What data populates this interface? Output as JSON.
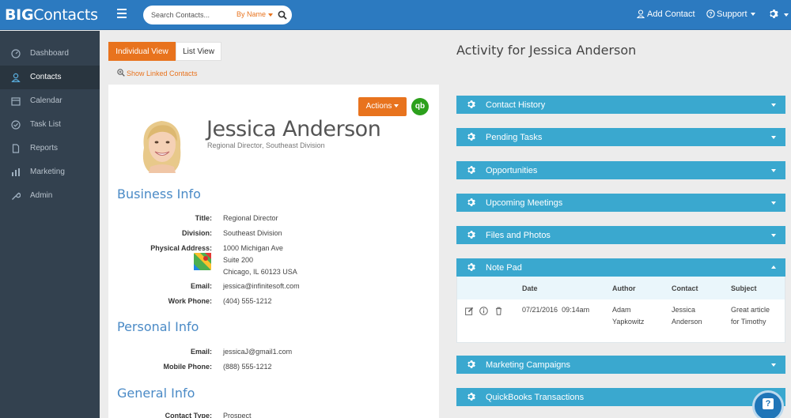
{
  "app": {
    "logo_bold": "BIG",
    "logo_thin": "Contacts"
  },
  "search": {
    "placeholder": "Search Contacts...",
    "mode": "By Name"
  },
  "header": {
    "add_contact": "Add Contact",
    "support": "Support"
  },
  "sidebar": {
    "items": [
      {
        "label": "Dashboard",
        "icon": "dashboard-icon"
      },
      {
        "label": "Contacts",
        "icon": "user-icon"
      },
      {
        "label": "Calendar",
        "icon": "calendar-icon"
      },
      {
        "label": "Task List",
        "icon": "check-circle-icon"
      },
      {
        "label": "Reports",
        "icon": "file-icon"
      },
      {
        "label": "Marketing",
        "icon": "bar-chart-icon"
      },
      {
        "label": "Admin",
        "icon": "wrench-icon"
      }
    ],
    "active": "Contacts"
  },
  "views": {
    "individual": "Individual View",
    "list": "List View",
    "linked": "Show Linked Contacts"
  },
  "contact": {
    "name": "Jessica Anderson",
    "subtitle": "Regional Director,  Southeast Division",
    "actions_label": "Actions",
    "qb_label": "qb"
  },
  "business": {
    "heading": "Business Info",
    "title_label": "Title:",
    "title": "Regional Director",
    "division_label": "Division:",
    "division": "Southeast Division",
    "address_label": "Physical Address:",
    "address_line1": "1000 Michigan Ave",
    "address_line2": "Suite 200",
    "address_line3": "Chicago, IL 60123 USA",
    "email_label": "Email:",
    "email": "jessica@infinitesoft.com",
    "phone_label": "Work Phone:",
    "phone": "(404) 555-1212"
  },
  "personal": {
    "heading": "Personal Info",
    "email_label": "Email:",
    "email": "jessicaJ@gmail1.com",
    "mobile_label": "Mobile Phone:",
    "mobile": "(888) 555-1212"
  },
  "general": {
    "heading": "General Info",
    "type_label": "Contact Type:",
    "type": "Prospect"
  },
  "activity": {
    "title": "Activity for Jessica Anderson",
    "panels": [
      "Contact History",
      "Pending Tasks",
      "Opportunities",
      "Upcoming Meetings",
      "Files and Photos",
      "Note Pad",
      "Marketing Campaigns",
      "QuickBooks Transactions"
    ]
  },
  "notepad": {
    "columns": [
      "Date",
      "Author",
      "Contact",
      "Subject"
    ],
    "row": {
      "date": "07/21/2016",
      "time": "09:14am",
      "author_line1": "Adam",
      "author_line2": "Yapkowitz",
      "contact_line1": "Jessica",
      "contact_line2": "Anderson",
      "subject_line1": "Great article",
      "subject_line2": "for Timothy"
    }
  },
  "colors": {
    "topbar": "#2c7ac0",
    "sidebar": "#33414f",
    "accent_orange": "#e8731e",
    "panel_blue": "#3aa8cf",
    "heading_blue": "#4a8ac6"
  }
}
